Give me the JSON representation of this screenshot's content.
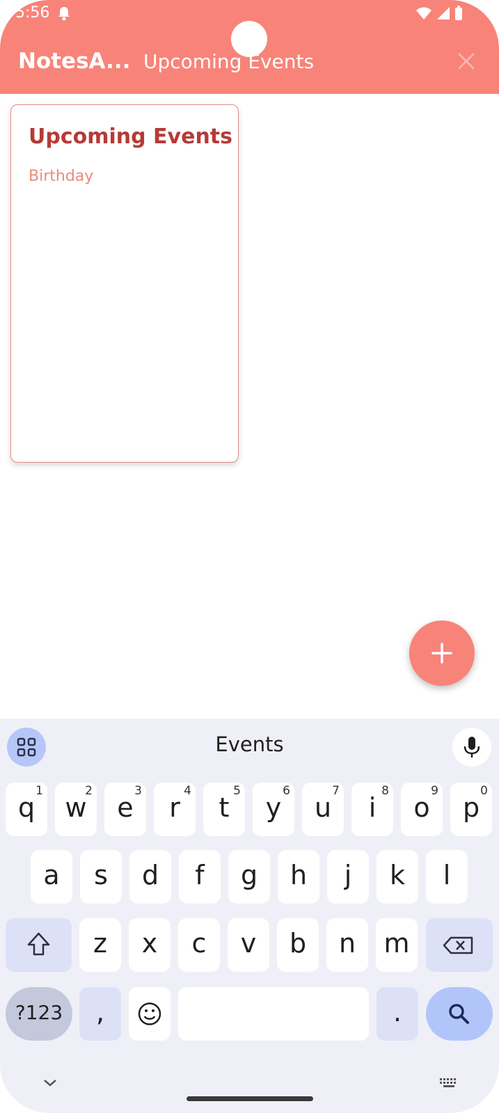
{
  "status_bar": {
    "time": "5:56"
  },
  "app_bar": {
    "title": "NotesA...",
    "search_text": "Upcoming Events",
    "colors": {
      "background": "#f88379",
      "foreground": "#ffffff"
    }
  },
  "notes": [
    {
      "title": "Upcoming Events",
      "body": "Birthday"
    }
  ],
  "fab": {
    "icon": "plus-icon"
  },
  "keyboard": {
    "suggestion": "Events",
    "row1": [
      {
        "key": "q",
        "sup": "1"
      },
      {
        "key": "w",
        "sup": "2"
      },
      {
        "key": "e",
        "sup": "3"
      },
      {
        "key": "r",
        "sup": "4"
      },
      {
        "key": "t",
        "sup": "5"
      },
      {
        "key": "y",
        "sup": "6"
      },
      {
        "key": "u",
        "sup": "7"
      },
      {
        "key": "i",
        "sup": "8"
      },
      {
        "key": "o",
        "sup": "9"
      },
      {
        "key": "p",
        "sup": "0"
      }
    ],
    "row2": [
      "a",
      "s",
      "d",
      "f",
      "g",
      "h",
      "j",
      "k",
      "l"
    ],
    "row3": [
      "z",
      "x",
      "c",
      "v",
      "b",
      "n",
      "m"
    ],
    "symbols_label": "?123",
    "comma_label": ",",
    "period_label": "."
  }
}
